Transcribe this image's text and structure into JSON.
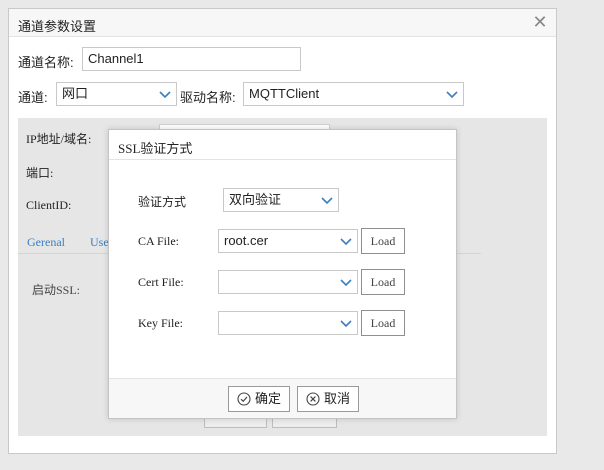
{
  "dialog": {
    "title": "通道参数设置",
    "close_icon": "close-icon",
    "channel_name_label": "通道名称:",
    "channel_name_value": "Channel1",
    "channel_label": "通道:",
    "channel_value": "网口",
    "driver_label": "驱动名称:",
    "driver_value": "MQTTClient",
    "ip_label": "IP地址/域名:",
    "port_label": "端口:",
    "clientid_label": "ClientID:",
    "tabs": [
      {
        "label": "Gerenal"
      },
      {
        "label": "Use"
      }
    ],
    "enable_ssl_label": "启动SSL:"
  },
  "ssl_modal": {
    "title": "SSL验证方式",
    "verify_label": "验证方式",
    "verify_value": "双向验证",
    "ca_label": "CA File:",
    "ca_value": "root.cer",
    "cert_label": "Cert File:",
    "cert_value": "",
    "key_label": "Key File:",
    "key_value": "",
    "load_label": "Load",
    "ok_label": "确定",
    "cancel_label": "取消"
  },
  "colors": {
    "accent_arrow": "#3a7fc0",
    "tab_text": "#3a7fc0",
    "panel_bg": "#e6e6e6"
  }
}
